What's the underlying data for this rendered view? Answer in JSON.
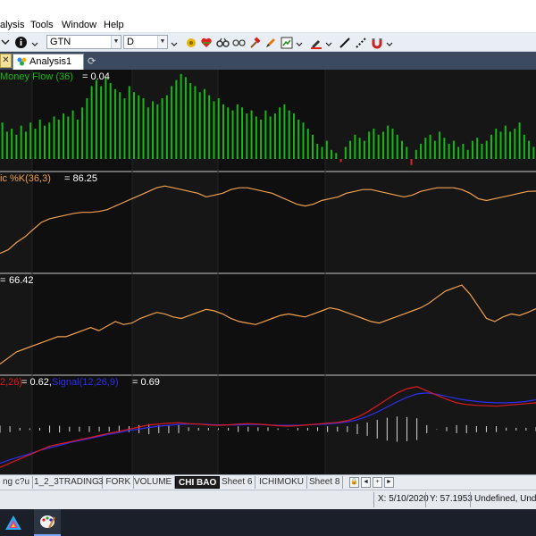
{
  "menu": {
    "items": [
      "alysis",
      "Tools",
      "Window",
      "Help"
    ]
  },
  "toolbar": {
    "symbol": "GTN",
    "interval": "D",
    "icons": [
      "info-icon",
      "reset-icon",
      "heart-icon",
      "binoculars-icon",
      "glasses-icon",
      "hammer-icon",
      "edit-icon",
      "chart-icon",
      "pen-icon",
      "line-icon",
      "dashed-line-icon",
      "magnet-icon"
    ]
  },
  "tabs": {
    "active_label": "Analysis1"
  },
  "panes": {
    "money_flow": {
      "name": "Money Flow (36)",
      "value": "= 0.04"
    },
    "stochastic": {
      "name": "ic %K(36,3)",
      "value": "= 86.25"
    },
    "rsi": {
      "value": "66.42"
    },
    "macd": {
      "name": "2,26)",
      "value": "= 0.62,",
      "signal_name": "Signal(12,26,9)",
      "signal_value": "= 0.69"
    }
  },
  "colors": {
    "background": "#0f0f0f",
    "money_flow_bars": "#16b816",
    "money_flow_negative": "#e0202a",
    "stochastic_line": "#f0a050",
    "rsi_line": "#f0a050",
    "macd_line": "#e01a1a",
    "signal_line": "#2e2ef0",
    "histogram": "#d8d8d8"
  },
  "sheets": [
    "ng c?u",
    "1_2_3TRADING",
    "3 FORK",
    "VOLUME",
    "CHI BAO",
    "Sheet 6",
    "ICHIMOKU",
    "Sheet 8"
  ],
  "active_sheet": "CHI BAO",
  "status": {
    "date": "X: 5/10/2020",
    "y_value": "Y: 57.1953",
    "extra": "Undefined, Unde"
  },
  "chart_data": [
    {
      "type": "bar",
      "pane": "Money Flow (36)",
      "series": [
        {
          "name": "Money Flow (36)",
          "values": [
            0.12,
            0.09,
            0.1,
            0.08,
            0.11,
            0.09,
            0.12,
            0.1,
            0.13,
            0.11,
            0.12,
            0.14,
            0.13,
            0.15,
            0.14,
            0.16,
            0.13,
            0.17,
            0.2,
            0.24,
            0.26,
            0.24,
            0.27,
            0.25,
            0.23,
            0.22,
            0.2,
            0.24,
            0.22,
            0.21,
            0.2,
            0.17,
            0.19,
            0.18,
            0.2,
            0.21,
            0.24,
            0.26,
            0.28,
            0.27,
            0.25,
            0.24,
            0.22,
            0.23,
            0.21,
            0.19,
            0.2,
            0.18,
            0.17,
            0.16,
            0.18,
            0.17,
            0.15,
            0.16,
            0.14,
            0.13,
            0.16,
            0.14,
            0.15,
            0.17,
            0.18,
            0.16,
            0.15,
            0.13,
            0.12,
            0.1,
            0.08,
            0.05,
            0.04,
            0.06,
            0.03,
            0.02,
            -0.01,
            0.04,
            0.06,
            0.08,
            0.07,
            0.06,
            0.09,
            0.1,
            0.08,
            0.09,
            0.11,
            0.1,
            0.08,
            0.06,
            0.04,
            -0.02,
            0.03,
            0.05,
            0.07,
            0.08,
            0.06,
            0.09,
            0.07,
            0.05,
            0.06,
            0.04,
            0.05,
            0.03,
            0.06,
            0.07,
            0.05,
            0.06,
            0.08,
            0.1,
            0.09,
            0.11,
            0.09,
            0.1,
            0.12,
            0.08,
            0.06,
            0.04
          ]
        }
      ]
    },
    {
      "type": "line",
      "pane": "Stochastic %K(36,3)",
      "ylim": [
        0,
        100
      ],
      "series": [
        {
          "name": "ic %K(36,3)",
          "values": [
            18,
            22,
            30,
            36,
            44,
            52,
            56,
            58,
            60,
            62,
            63,
            63,
            64,
            66,
            70,
            74,
            78,
            82,
            86,
            90,
            92,
            90,
            88,
            86,
            84,
            80,
            82,
            84,
            88,
            90,
            90,
            88,
            86,
            84,
            80,
            76,
            72,
            70,
            72,
            76,
            78,
            80,
            84,
            86,
            88,
            88,
            86,
            84,
            82,
            80,
            82,
            86,
            88,
            90,
            90,
            90,
            88,
            84,
            78,
            76,
            78,
            80,
            82,
            84,
            86,
            86.25
          ]
        }
      ]
    },
    {
      "type": "line",
      "pane": "RSI",
      "series": [
        {
          "values": [
            30,
            34,
            38,
            40,
            42,
            44,
            46,
            48,
            48,
            50,
            52,
            54,
            52,
            55,
            58,
            56,
            57,
            60,
            62,
            64,
            63,
            61,
            60,
            62,
            64,
            66,
            65,
            63,
            60,
            58,
            57,
            56,
            58,
            60,
            62,
            63,
            62,
            61,
            63,
            65,
            67,
            66,
            64,
            62,
            60,
            58,
            57,
            59,
            61,
            63,
            65,
            67,
            70,
            74,
            78,
            80,
            82,
            76,
            68,
            60,
            58,
            61,
            63,
            62,
            64,
            66.42
          ]
        }
      ]
    },
    {
      "type": "line",
      "pane": "MACD",
      "series": [
        {
          "name": "2,26)",
          "values": [
            -0.9,
            -0.8,
            -0.7,
            -0.6,
            -0.5,
            -0.4,
            -0.35,
            -0.3,
            -0.25,
            -0.2,
            -0.15,
            -0.1,
            -0.05,
            0.0,
            0.05,
            0.1,
            0.12,
            0.14,
            0.15,
            0.13,
            0.12,
            0.1,
            0.09,
            0.1,
            0.12,
            0.13,
            0.12,
            0.1,
            0.08,
            0.07,
            0.08,
            0.1,
            0.12,
            0.14,
            0.16,
            0.2,
            0.28,
            0.4,
            0.55,
            0.7,
            0.85,
            0.95,
            1.0,
            0.9,
            0.8,
            0.7,
            0.62,
            0.58,
            0.56,
            0.55,
            0.54,
            0.56,
            0.58,
            0.6,
            0.62
          ]
        },
        {
          "name": "Signal(12,26,9)",
          "values": [
            -0.8,
            -0.72,
            -0.65,
            -0.58,
            -0.5,
            -0.44,
            -0.38,
            -0.32,
            -0.27,
            -0.22,
            -0.17,
            -0.12,
            -0.08,
            -0.03,
            0.0,
            0.04,
            0.07,
            0.09,
            0.11,
            0.12,
            0.12,
            0.11,
            0.1,
            0.1,
            0.1,
            0.11,
            0.11,
            0.1,
            0.09,
            0.09,
            0.09,
            0.1,
            0.11,
            0.12,
            0.14,
            0.17,
            0.22,
            0.3,
            0.4,
            0.52,
            0.64,
            0.75,
            0.83,
            0.85,
            0.82,
            0.77,
            0.72,
            0.68,
            0.65,
            0.63,
            0.62,
            0.62,
            0.63,
            0.65,
            0.69
          ]
        }
      ]
    }
  ]
}
